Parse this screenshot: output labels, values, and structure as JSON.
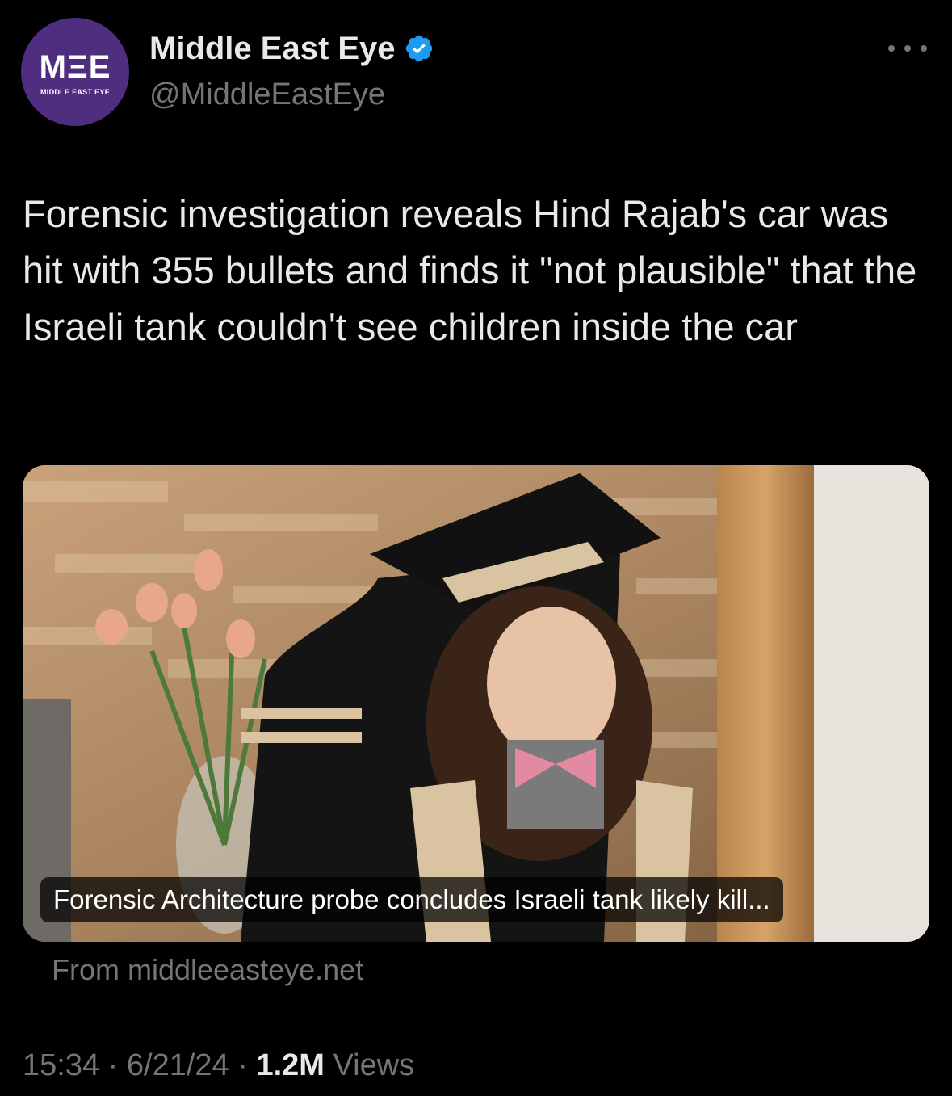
{
  "author": {
    "avatar_mark": "MΞE",
    "avatar_text": "MIDDLE EAST EYE",
    "display_name": "Middle East Eye",
    "handle": "@MiddleEastEye",
    "verified": true,
    "brand_color": "#4f2d7f",
    "verified_color": "#1d9bf0"
  },
  "tweet": {
    "text": "Forensic investigation reveals Hind Rajab's car was hit with 355 bullets and finds it \"not plausible\" that the Israeli tank couldn't see children inside the car"
  },
  "link_card": {
    "image_icon": "photo-graduation-child",
    "caption": "Forensic Architecture probe concludes Israeli tank likely kill...",
    "source": "From middleeasteye.net"
  },
  "meta": {
    "time": "15:34",
    "sep1": " · ",
    "date": "6/21/24",
    "sep2": " · ",
    "views_count": "1.2M",
    "views_label": " Views"
  }
}
